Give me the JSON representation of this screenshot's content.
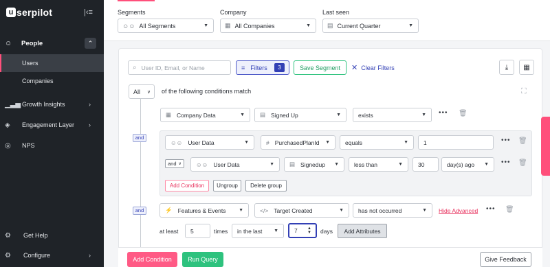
{
  "sidebar": {
    "logo_badge": "u",
    "logo_text": "serpilot",
    "collapse_icon": "collapse-left-icon",
    "people": {
      "label": "People",
      "subitems": [
        "Users",
        "Companies"
      ]
    },
    "items": [
      {
        "label": "Growth Insights",
        "icon": "chart-icon"
      },
      {
        "label": "Engagement Layer",
        "icon": "layers-icon"
      },
      {
        "label": "NPS",
        "icon": "nps-icon"
      }
    ],
    "bottom": [
      {
        "label": "Get Help",
        "icon": "help-icon"
      },
      {
        "label": "Configure",
        "icon": "gear-icon"
      }
    ]
  },
  "filters": {
    "segments": {
      "label": "Segments",
      "value": "All Segments"
    },
    "company": {
      "label": "Company",
      "value": "All Companies"
    },
    "last_seen": {
      "label": "Last seen",
      "value": "Current Quarter"
    }
  },
  "toolbar": {
    "search_placeholder": "User ID, Email, or Name",
    "filters_label": "Filters",
    "filters_count": "3",
    "save_segment": "Save Segment",
    "clear_filters": "Clear Filters"
  },
  "conditions": {
    "match_mode": "All",
    "match_text": "of the following conditions match",
    "and_label": "and",
    "row1": {
      "source": "Company Data",
      "field": "Signed Up",
      "operator": "exists"
    },
    "group": {
      "row1": {
        "source": "User Data",
        "field": "PurchasedPlanId",
        "operator": "equals",
        "value": "1"
      },
      "row2": {
        "connector": "and",
        "source": "User Data",
        "field": "Signedup",
        "operator": "less than",
        "value": "30",
        "unit": "day(s) ago"
      },
      "add_condition": "Add Condition",
      "ungroup": "Ungroup",
      "delete_group": "Delete group"
    },
    "row3": {
      "source": "Features & Events",
      "field": "Target Created",
      "operator": "has not occurred",
      "hide_advanced": "Hide Advanced",
      "at_least": "at least",
      "times_value": "5",
      "times_label": "times",
      "window": "in the last",
      "days_value": "7",
      "days_label": "days",
      "add_attributes": "Add Attributes"
    }
  },
  "footer": {
    "add_condition": "Add Condition",
    "run_query": "Run Query",
    "give_feedback": "Give Feedback"
  },
  "colors": {
    "accent": "#ff4f7b",
    "primary": "#3340b5",
    "success": "#2ec27e",
    "sidebar": "#1f2328"
  }
}
